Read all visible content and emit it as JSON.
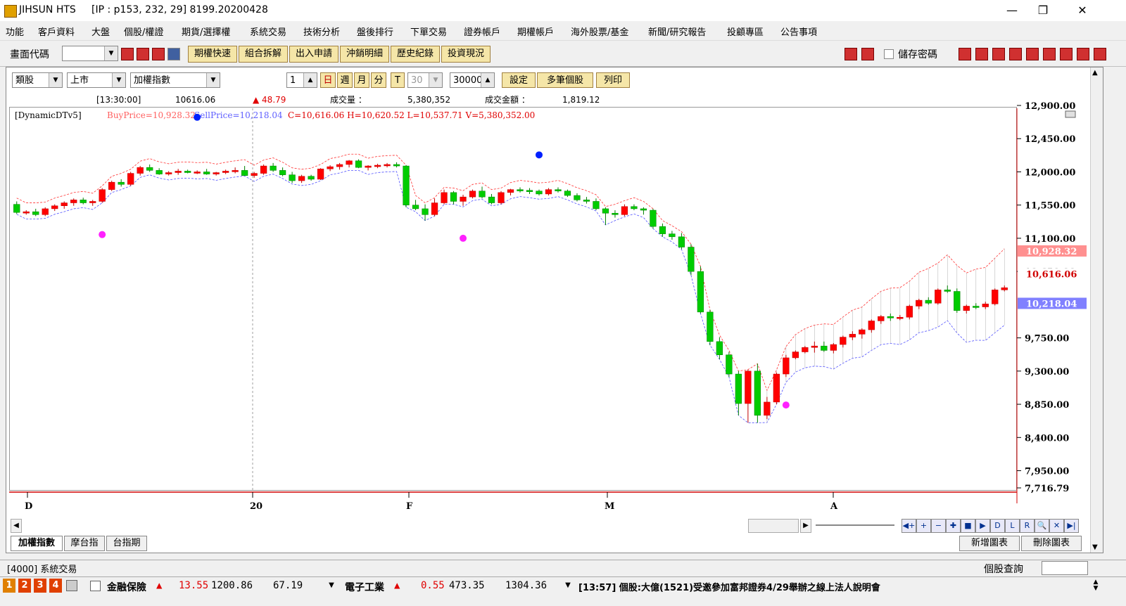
{
  "window": {
    "app_name": "JIHSUN HTS",
    "connection": "[IP : p153, 232, 29] 8199.20200428"
  },
  "menu": [
    "功能",
    "客戶資料",
    "大盤",
    "個股/權證",
    "期貨/選擇權",
    "系統交易",
    "技術分析",
    "盤後排行",
    "下單交易",
    "證券帳戶",
    "期權帳戶",
    "海外股票/基金",
    "新聞/研究報告",
    "投顧專區",
    "公告事項"
  ],
  "toolbar": {
    "screen_code_label": "畫面代碼",
    "buttons": [
      "期權快速",
      "組合拆解",
      "出入申請",
      "沖銷明細",
      "歷史紀錄",
      "投資現況"
    ],
    "save_password_label": "儲存密碼"
  },
  "chart_panel": {
    "category": "類股",
    "market": "上市",
    "index": "加權指數",
    "period_value": "1",
    "period_tabs": [
      "日",
      "週",
      "月",
      "分",
      "T"
    ],
    "minutes_value": "30",
    "count_value": "30000",
    "buttons": [
      "設定",
      "多筆個股",
      "列印"
    ],
    "quote": {
      "time": "[13:30:00]",
      "price": "10616.06",
      "change": "▲ 48.79",
      "volume_label": "成交量 ：",
      "volume": "5,380,352",
      "amount_label": "成交金額 ：",
      "amount": "1,819.12"
    },
    "indicator": "[DynamicDTv5]",
    "buy_price": "BuyPrice=10,928.32",
    "sell_price": "SellPrice=10,218.04",
    "ohlcv": "C=10,616.06 H=10,620.52 L=10,537.71 V=5,380,352.00"
  },
  "axis": {
    "y_ticks": [
      "12,900.00",
      "12,450.00",
      "12,000.00",
      "11,550.00",
      "11,100.00",
      "10,650.00",
      "9,750.00",
      "9,300.00",
      "8,850.00",
      "8,400.00",
      "7,950.00",
      "7,716.79"
    ],
    "buy_tag": "10,928.32",
    "close_tag": "10,616.06",
    "sell_tag": "10,218.04",
    "x_labels": [
      "D",
      "20",
      "F",
      "M",
      "A"
    ]
  },
  "colors": {
    "up": "#ff0000",
    "down": "#00cc00",
    "buy_band": "#ff3030",
    "sell_band": "#5050ff"
  },
  "tabs": [
    "加權指數",
    "摩台指",
    "台指期"
  ],
  "right_buttons": [
    "新增圖表",
    "刪除圖表"
  ],
  "status": {
    "left": "[4000] 系統交易",
    "right": "個股查詢"
  },
  "quotebar": {
    "pages": [
      "1",
      "2",
      "3",
      "4"
    ],
    "q1_name": "金融保險",
    "q1_change": "13.55",
    "q1_value": "1200.86",
    "q1_volume": "67.19",
    "q2_name": "電子工業",
    "q2_change": "0.55",
    "q2_value": "473.35",
    "q2_volume": "1304.36",
    "news": "[13:57] 個股:大億(1521)受邀參加富邦證券4/29舉辦之線上法人說明會"
  },
  "chart_data": {
    "type": "candlestick",
    "y_range": [
      7716.79,
      12900
    ],
    "candles": [
      [
        11560,
        11600,
        11430,
        11450
      ],
      [
        11450,
        11480,
        11420,
        11460
      ],
      [
        11460,
        11500,
        11400,
        11420
      ],
      [
        11420,
        11520,
        11400,
        11500
      ],
      [
        11500,
        11560,
        11470,
        11540
      ],
      [
        11540,
        11600,
        11500,
        11580
      ],
      [
        11580,
        11640,
        11540,
        11620
      ],
      [
        11620,
        11650,
        11560,
        11580
      ],
      [
        11580,
        11620,
        11540,
        11600
      ],
      [
        11600,
        11780,
        11580,
        11760
      ],
      [
        11760,
        11880,
        11740,
        11860
      ],
      [
        11860,
        11900,
        11800,
        11830
      ],
      [
        11830,
        12000,
        11810,
        11980
      ],
      [
        11980,
        12080,
        11950,
        12060
      ],
      [
        12060,
        12100,
        12000,
        12020
      ],
      [
        12020,
        12050,
        11960,
        11970
      ],
      [
        11970,
        12010,
        11950,
        11990
      ],
      [
        11990,
        12040,
        11960,
        12010
      ],
      [
        12010,
        12030,
        11980,
        11990
      ],
      [
        11990,
        12020,
        11970,
        12000
      ],
      [
        12000,
        12040,
        11960,
        11970
      ],
      [
        11970,
        12000,
        11950,
        11990
      ],
      [
        11990,
        12030,
        11970,
        12010
      ],
      [
        12010,
        12060,
        11980,
        12020
      ],
      [
        12020,
        12080,
        11990,
        11950
      ],
      [
        11950,
        12000,
        11920,
        11980
      ],
      [
        11980,
        12100,
        11960,
        12080
      ],
      [
        12080,
        12120,
        12000,
        12020
      ],
      [
        12020,
        12060,
        11940,
        11960
      ],
      [
        11960,
        12000,
        11850,
        11880
      ],
      [
        11880,
        11960,
        11850,
        11940
      ],
      [
        11940,
        11960,
        11880,
        11900
      ],
      [
        11900,
        12050,
        11890,
        12040
      ],
      [
        12040,
        12090,
        12010,
        12070
      ],
      [
        12070,
        12120,
        12030,
        12100
      ],
      [
        12100,
        12160,
        12060,
        12150
      ],
      [
        12150,
        12170,
        12050,
        12060
      ],
      [
        12060,
        12090,
        12020,
        12080
      ],
      [
        12080,
        12110,
        12050,
        12090
      ],
      [
        12090,
        12120,
        12060,
        12100
      ],
      [
        12100,
        12130,
        12060,
        12080
      ],
      [
        12080,
        12090,
        11520,
        11550
      ],
      [
        11550,
        11620,
        11480,
        11500
      ],
      [
        11500,
        11560,
        11340,
        11420
      ],
      [
        11420,
        11640,
        11400,
        11580
      ],
      [
        11580,
        11760,
        11560,
        11720
      ],
      [
        11720,
        11740,
        11560,
        11600
      ],
      [
        11600,
        11690,
        11540,
        11660
      ],
      [
        11660,
        11760,
        11640,
        11740
      ],
      [
        11740,
        11800,
        11640,
        11660
      ],
      [
        11660,
        11700,
        11560,
        11580
      ],
      [
        11580,
        11740,
        11560,
        11720
      ],
      [
        11720,
        11770,
        11680,
        11760
      ],
      [
        11760,
        11790,
        11720,
        11750
      ],
      [
        11750,
        11780,
        11700,
        11740
      ],
      [
        11740,
        11760,
        11680,
        11700
      ],
      [
        11700,
        11780,
        11680,
        11760
      ],
      [
        11760,
        11790,
        11720,
        11740
      ],
      [
        11740,
        11760,
        11660,
        11680
      ],
      [
        11680,
        11710,
        11600,
        11620
      ],
      [
        11620,
        11660,
        11570,
        11600
      ],
      [
        11600,
        11640,
        11480,
        11500
      ],
      [
        11500,
        11520,
        11280,
        11440
      ],
      [
        11440,
        11480,
        11380,
        11420
      ],
      [
        11420,
        11560,
        11400,
        11530
      ],
      [
        11530,
        11560,
        11480,
        11500
      ],
      [
        11500,
        11520,
        11420,
        11480
      ],
      [
        11480,
        11500,
        11230,
        11260
      ],
      [
        11260,
        11300,
        11120,
        11160
      ],
      [
        11160,
        11200,
        11080,
        11120
      ],
      [
        11120,
        11170,
        10950,
        10980
      ],
      [
        10980,
        11020,
        10600,
        10650
      ],
      [
        10650,
        10720,
        10080,
        10100
      ],
      [
        10100,
        10130,
        9650,
        9700
      ],
      [
        9700,
        9760,
        9460,
        9520
      ],
      [
        9520,
        9560,
        9220,
        9260
      ],
      [
        9260,
        9300,
        8700,
        8860
      ],
      [
        8860,
        9320,
        8600,
        9300
      ],
      [
        9300,
        9400,
        8600,
        8700
      ],
      [
        8700,
        8950,
        8650,
        8880
      ],
      [
        8880,
        9280,
        8850,
        9260
      ],
      [
        9260,
        9520,
        9220,
        9480
      ],
      [
        9480,
        9580,
        9460,
        9560
      ],
      [
        9560,
        9640,
        9540,
        9620
      ],
      [
        9620,
        9700,
        9550,
        9640
      ],
      [
        9640,
        9700,
        9560,
        9580
      ],
      [
        9580,
        9680,
        9540,
        9660
      ],
      [
        9660,
        9780,
        9620,
        9760
      ],
      [
        9760,
        9840,
        9720,
        9800
      ],
      [
        9800,
        9880,
        9740,
        9860
      ],
      [
        9860,
        10000,
        9820,
        9980
      ],
      [
        9980,
        10060,
        9940,
        10040
      ],
      [
        10040,
        10080,
        9980,
        10020
      ],
      [
        10020,
        10060,
        9990,
        10030
      ],
      [
        10030,
        10200,
        10000,
        10180
      ],
      [
        10180,
        10280,
        10140,
        10260
      ],
      [
        10260,
        10300,
        10200,
        10220
      ],
      [
        10220,
        10420,
        10200,
        10400
      ],
      [
        10400,
        10460,
        10360,
        10380
      ],
      [
        10380,
        10420,
        10090,
        10120
      ],
      [
        10120,
        10200,
        10080,
        10180
      ],
      [
        10180,
        10220,
        10140,
        10170
      ],
      [
        10170,
        10240,
        10140,
        10210
      ],
      [
        10210,
        10420,
        10190,
        10400
      ],
      [
        10400,
        10460,
        10380,
        10430
      ]
    ],
    "special_dots": [
      {
        "i": 19,
        "v": 12740,
        "c": "blue"
      },
      {
        "i": 55,
        "v": 12230,
        "c": "blue"
      },
      {
        "i": 9,
        "v": 11150,
        "c": "magenta"
      },
      {
        "i": 47,
        "v": 11100,
        "c": "magenta"
      },
      {
        "i": 81,
        "v": 8840,
        "c": "magenta"
      }
    ],
    "series": [
      {
        "name": "BuyPrice",
        "value": 10928.32
      },
      {
        "name": "SellPrice",
        "value": 10218.04
      },
      {
        "name": "C",
        "value": 10616.06
      }
    ]
  }
}
